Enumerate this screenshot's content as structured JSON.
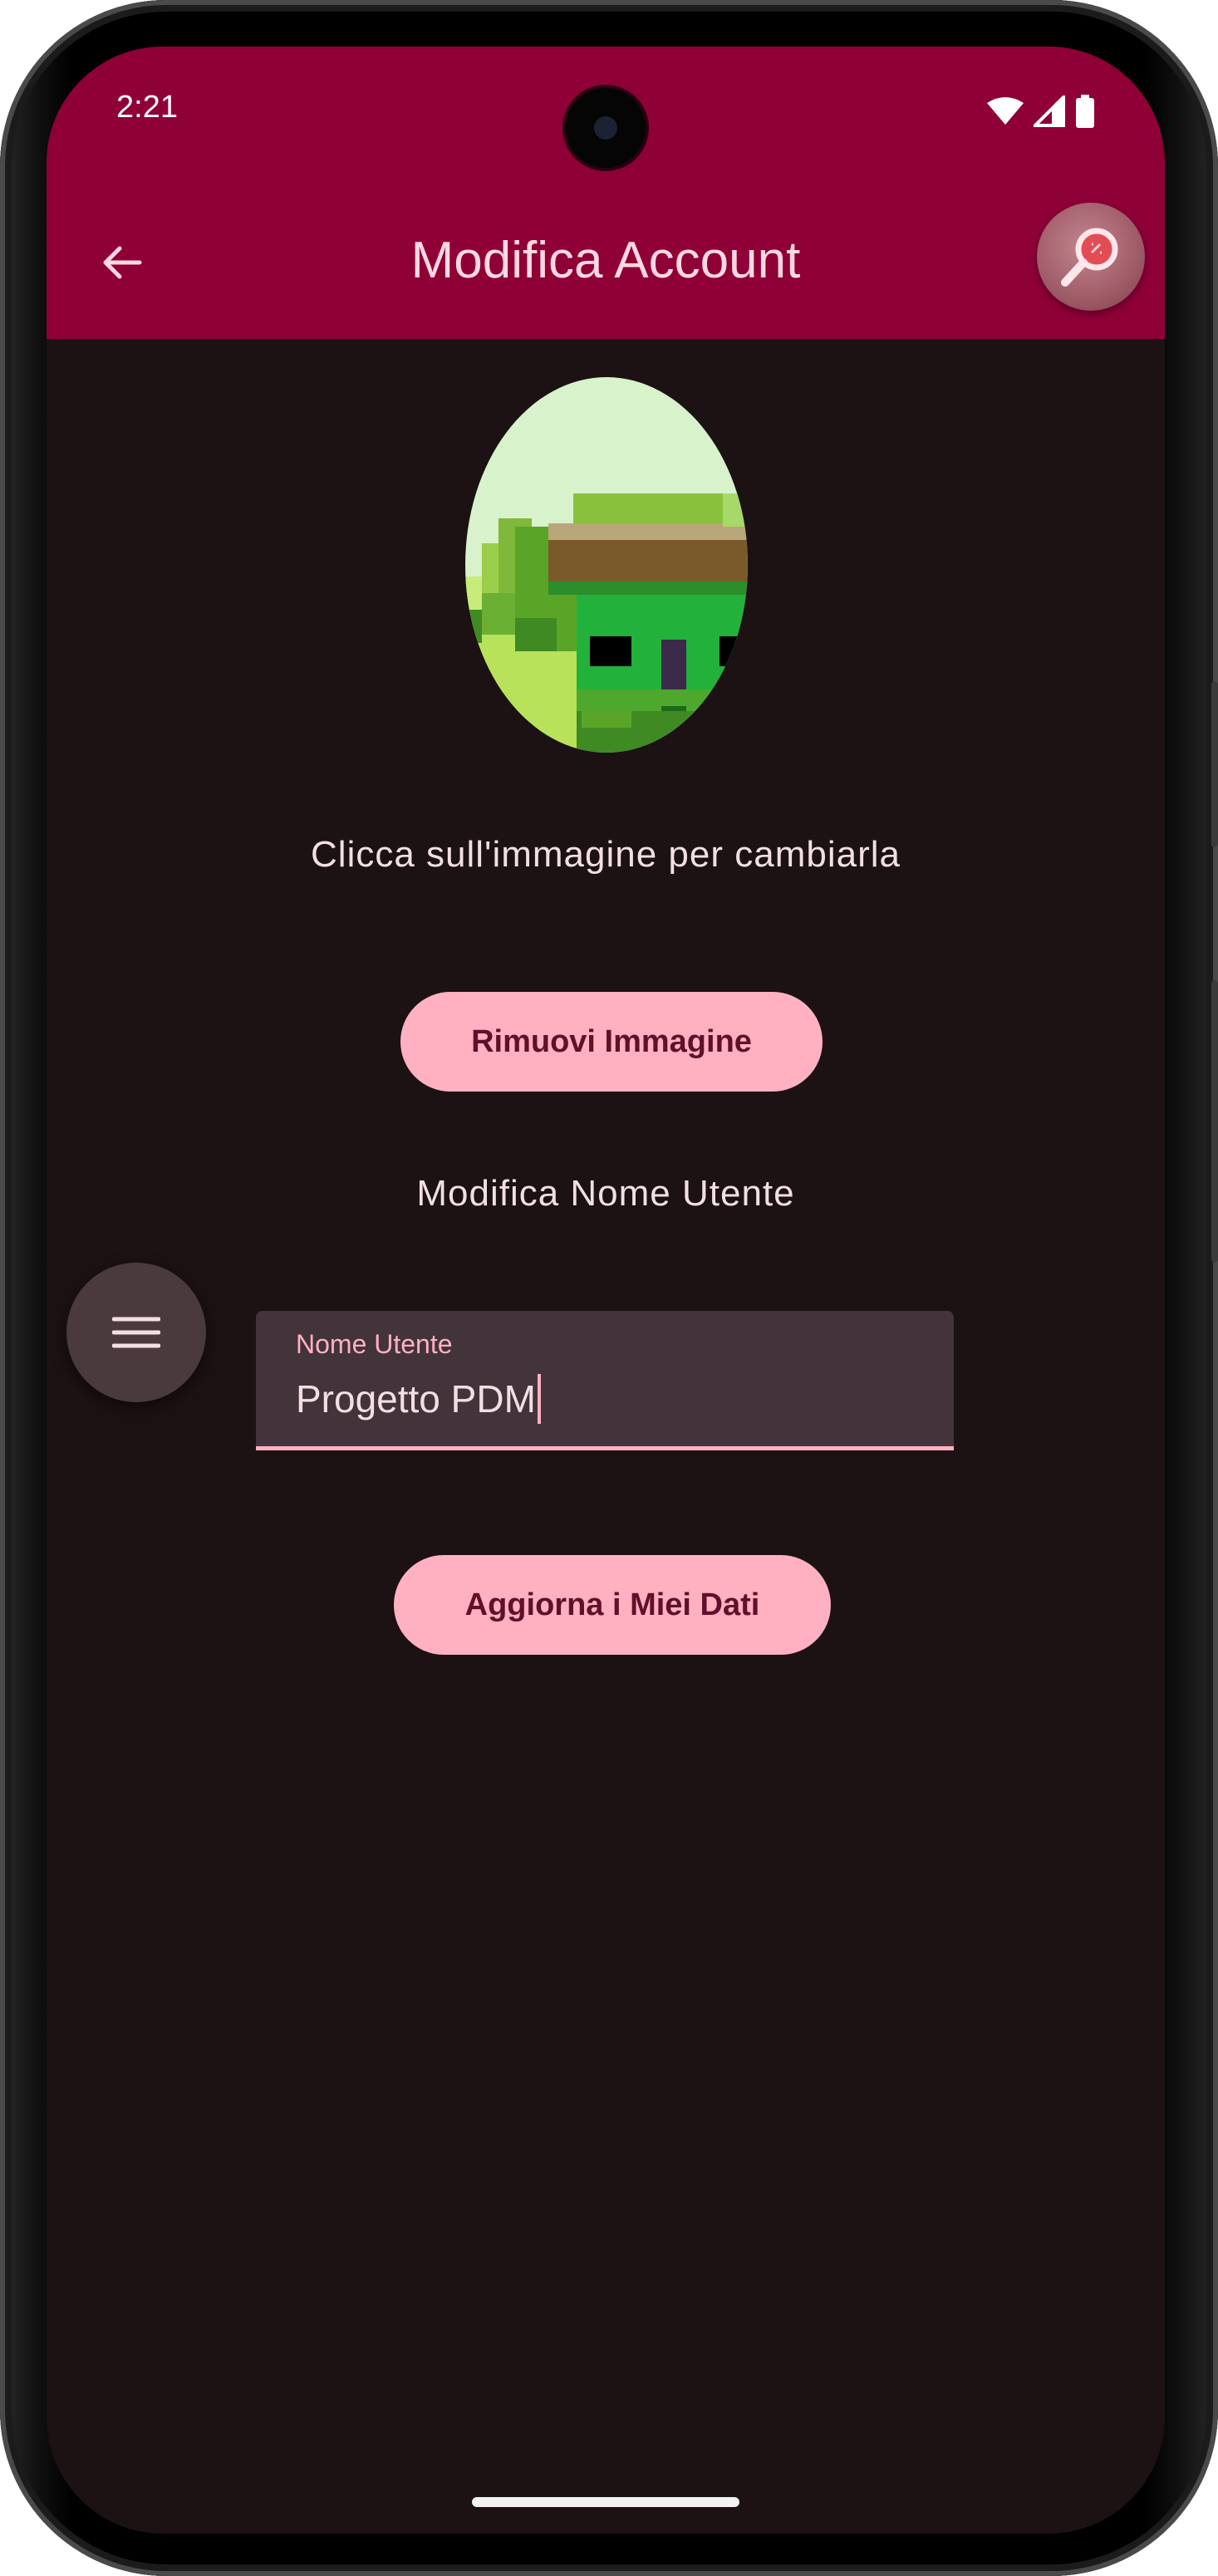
{
  "status_bar": {
    "time": "2:21",
    "icons": [
      "wifi-icon",
      "signal-icon",
      "battery-icon"
    ]
  },
  "app_bar": {
    "title": "Modifica Account",
    "back_icon": "arrow-back-icon",
    "action_icon": "search-icon"
  },
  "profile": {
    "image_hint": "Clicca sull'immagine per cambiarla",
    "remove_button": "Rimuovi Immagine"
  },
  "username_section": {
    "heading": "Modifica Nome Utente",
    "field_label": "Nome Utente",
    "field_value": "Progetto PDM"
  },
  "update_button": "Aggiorna i Miei Dati",
  "fab_icon": "menu-icon",
  "colors": {
    "app_bar": "#8f0037",
    "background": "#1c1113",
    "accent": "#ffb1c1",
    "field_bg": "#43333a"
  }
}
